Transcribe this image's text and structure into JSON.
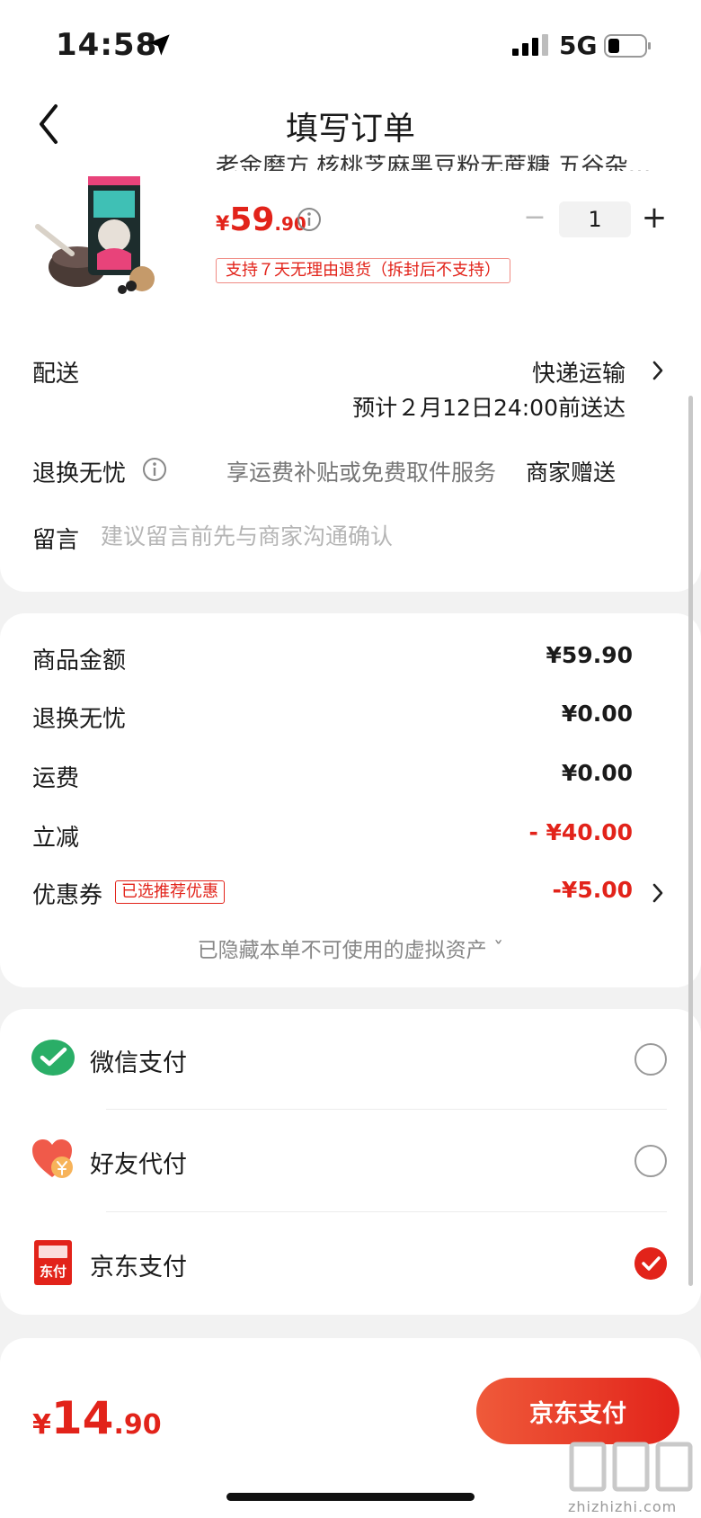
{
  "status_bar": {
    "time": "14:58",
    "network": "5G"
  },
  "nav": {
    "title": "填写订单"
  },
  "product": {
    "title": "老金磨方 核桃芝麻黑豆粉无蔗糖 五谷杂…",
    "price_currency": "¥",
    "price_integer": "59",
    "price_decimal": ".90",
    "quantity": "1",
    "minus_label": "−",
    "plus_label": "+",
    "return_policy": "支持７天无理由退货（拆封后不支持）"
  },
  "delivery": {
    "label": "配送",
    "method": "快递运输",
    "eta": "预计２月12日24:00前送达"
  },
  "worry_free": {
    "label": "退换无忧",
    "description": "享运费补贴或免费取件服务",
    "provider": "商家赠送"
  },
  "message": {
    "label": "留言",
    "placeholder": "建议留言前先与商家沟通确认"
  },
  "amounts": {
    "goods_label": "商品金额",
    "goods_value": "¥59.90",
    "worry_label": "退换无忧",
    "worry_value": "¥0.00",
    "shipping_label": "运费",
    "shipping_value": "¥0.00",
    "discount_label": "立减",
    "discount_value": "- ¥40.00",
    "coupon_label": "优惠券",
    "coupon_tag": "已选推荐优惠",
    "coupon_value": "-¥5.00",
    "hidden_assets": "已隐藏本单不可使用的虚拟资产 ˇ"
  },
  "payment": {
    "methods": [
      {
        "label": "微信支付",
        "icon": "wechat-pay-icon",
        "selected": false
      },
      {
        "label": "好友代付",
        "icon": "friend-pay-heart-icon",
        "selected": false
      },
      {
        "label": "京东支付",
        "icon": "jd-pay-icon",
        "icon_text": "东付",
        "selected": true
      }
    ]
  },
  "bottom": {
    "total_currency": "¥",
    "total_integer": "14",
    "total_decimal": ".90",
    "pay_button": "京东支付"
  },
  "watermark": {
    "text": "zhizhizhi.com"
  },
  "colors": {
    "accent": "#e2231a",
    "wechat": "#2aae67",
    "background": "#f2f2f2"
  }
}
